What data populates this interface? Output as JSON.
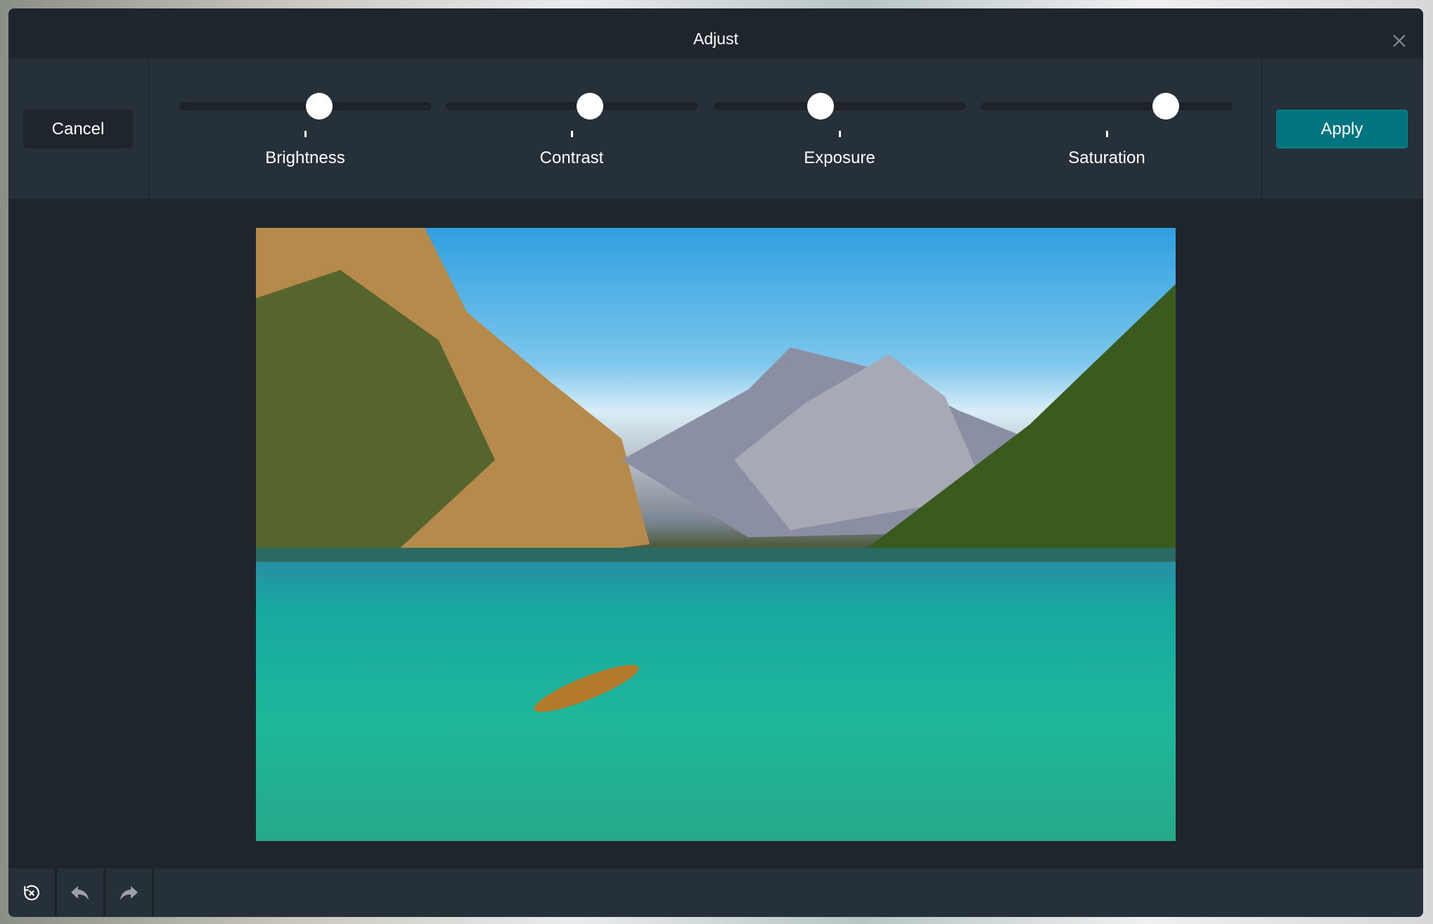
{
  "dialog": {
    "title": "Adjust",
    "close_icon": "close-icon"
  },
  "actions": {
    "cancel_label": "Cancel",
    "apply_label": "Apply",
    "apply_color": "#00747f"
  },
  "sliders": [
    {
      "label": "Brightness",
      "value": 0.556
    },
    {
      "label": "Contrast",
      "value": 0.572
    },
    {
      "label": "Exposure",
      "value": 0.425
    },
    {
      "label": "Saturation",
      "value": 0.735
    }
  ],
  "image": {
    "description_icon": "photo-preview"
  },
  "toolbar": {
    "items": [
      {
        "icon": "reset-icon"
      },
      {
        "icon": "undo-icon"
      },
      {
        "icon": "redo-icon"
      }
    ]
  }
}
